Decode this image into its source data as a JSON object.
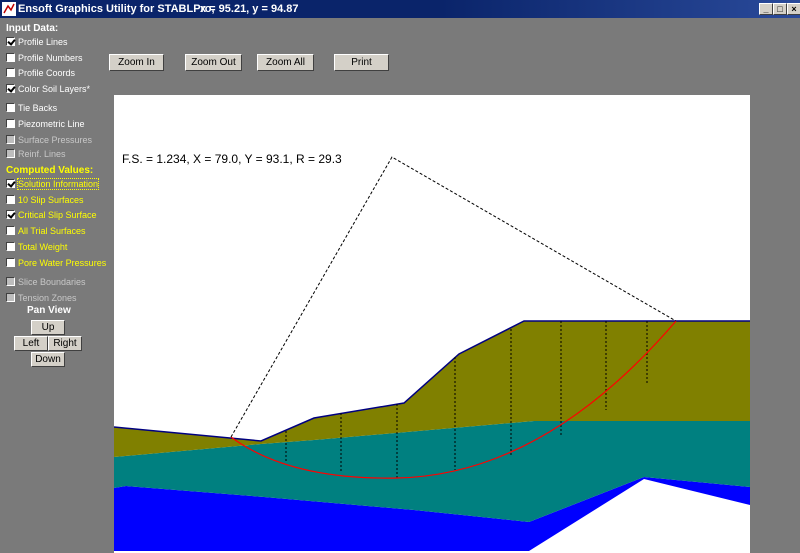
{
  "window": {
    "title": "Ensoft Graphics Utility for STABLPro,",
    "coords": "x = 95.21, y = 94.87",
    "minimize_label": "_",
    "restore_label": "□",
    "close_label": "×"
  },
  "sidebar": {
    "input_header": "Input Data:",
    "input_items": [
      {
        "label": "Profile Lines",
        "checked": true
      },
      {
        "label": "Profile Numbers",
        "checked": false
      },
      {
        "label": "Profile Coords",
        "checked": false
      },
      {
        "label": "Color Soil Layers*",
        "checked": true
      },
      {
        "label": "Tie Backs",
        "checked": false
      },
      {
        "label": "Piezometric Line",
        "checked": false
      },
      {
        "label": "Surface Pressures",
        "checked": false
      },
      {
        "label": "Reinf. Lines",
        "checked": false
      }
    ],
    "computed_header": "Computed Values:",
    "computed_items": [
      {
        "label": "Solution Information",
        "checked": true
      },
      {
        "label": "10 Slip Surfaces",
        "checked": false
      },
      {
        "label": "Critical Slip Surface",
        "checked": true
      },
      {
        "label": "All Trial Surfaces",
        "checked": false
      },
      {
        "label": "Total Weight",
        "checked": false
      },
      {
        "label": "Pore Water Pressures",
        "checked": false
      },
      {
        "label": "Slice Boundaries",
        "checked": false
      },
      {
        "label": "Tension Zones",
        "checked": false
      }
    ],
    "pan_header": "Pan View",
    "pan": {
      "up": "Up",
      "left": "Left",
      "right": "Right",
      "down": "Down"
    }
  },
  "toolbar": {
    "zoom_in": "Zoom In",
    "zoom_out": "Zoom Out",
    "zoom_all": "Zoom All",
    "print": "Print"
  },
  "plot": {
    "solution_text": "F.S. = 1.234, X = 79.0, Y = 93.1, R = 29.3"
  },
  "colors": {
    "accent_yellow": "#ffff00",
    "soil_top": "#808000",
    "soil_middle": "#008080",
    "soil_bottom": "#0000ff",
    "slip_surface": "#ff0000",
    "profile_line": "#000080"
  }
}
